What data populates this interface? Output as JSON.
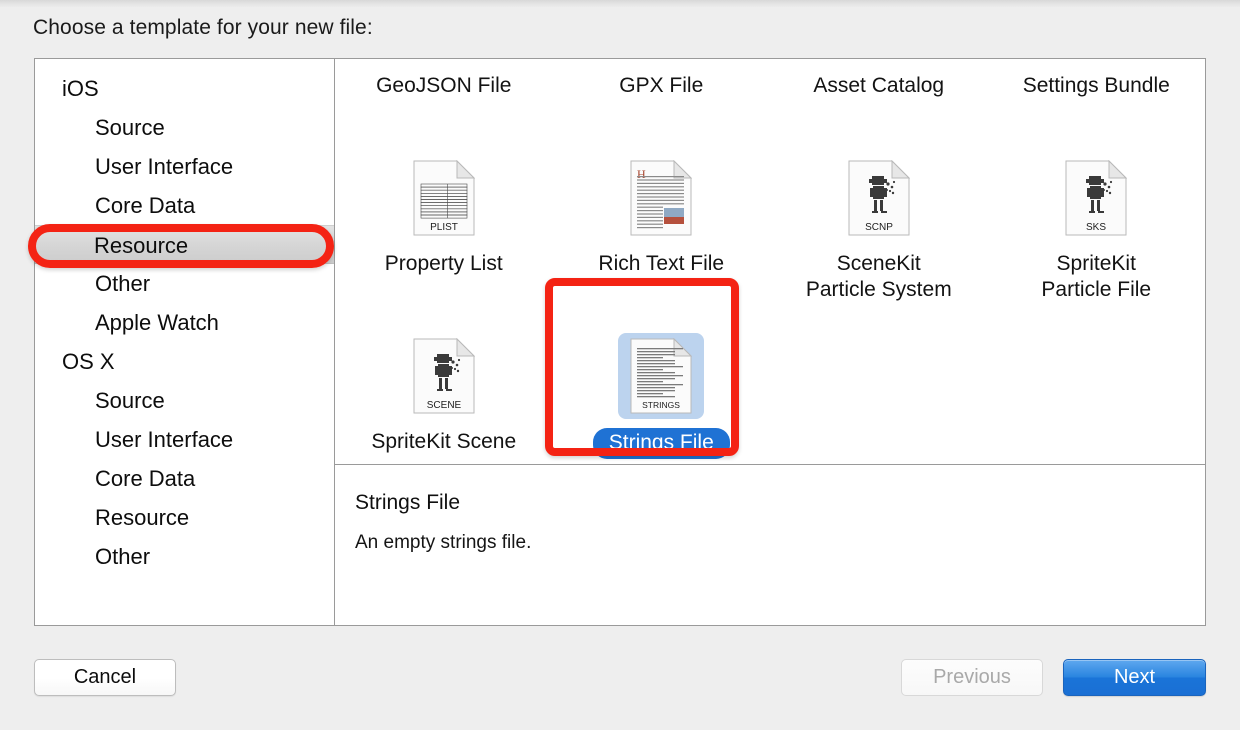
{
  "sheet": {
    "title": "Choose a template for your new file:"
  },
  "sidebar": {
    "groups": [
      {
        "label": "iOS",
        "items": [
          "Source",
          "User Interface",
          "Core Data",
          "Resource",
          "Other",
          "Apple Watch"
        ],
        "selected": "Resource"
      },
      {
        "label": "OS X",
        "items": [
          "Source",
          "User Interface",
          "Core Data",
          "Resource",
          "Other"
        ],
        "selected": null
      }
    ],
    "rows": [
      {
        "label": "iOS",
        "level": "group",
        "selected": false
      },
      {
        "label": "Source",
        "level": "child",
        "selected": false
      },
      {
        "label": "User Interface",
        "level": "child",
        "selected": false
      },
      {
        "label": "Core Data",
        "level": "child",
        "selected": false
      },
      {
        "label": "Resource",
        "level": "child",
        "selected": true
      },
      {
        "label": "Other",
        "level": "child",
        "selected": false
      },
      {
        "label": "Apple Watch",
        "level": "child",
        "selected": false
      },
      {
        "label": "OS X",
        "level": "group",
        "selected": false
      },
      {
        "label": "Source",
        "level": "child",
        "selected": false
      },
      {
        "label": "User Interface",
        "level": "child",
        "selected": false
      },
      {
        "label": "Core Data",
        "level": "child",
        "selected": false
      },
      {
        "label": "Resource",
        "level": "child",
        "selected": false
      },
      {
        "label": "Other",
        "level": "child",
        "selected": false
      }
    ]
  },
  "templates": {
    "tiles": [
      {
        "label": "GeoJSON File",
        "icon": "document-geojson-icon",
        "badge": "",
        "selected": false
      },
      {
        "label": "GPX File",
        "icon": "document-gpx-icon",
        "badge": "",
        "selected": false
      },
      {
        "label": "Asset Catalog",
        "icon": "asset-catalog-icon",
        "badge": "",
        "selected": false
      },
      {
        "label": "Settings Bundle",
        "icon": "settings-bundle-icon",
        "badge": "",
        "selected": false
      },
      {
        "label": "Property List",
        "icon": "document-plist-icon",
        "badge": "PLIST",
        "selected": false
      },
      {
        "label": "Rich Text File",
        "icon": "document-rtf-icon",
        "badge": "",
        "selected": false
      },
      {
        "label": "SceneKit\nParticle System",
        "icon": "document-scnp-icon",
        "badge": "SCNP",
        "selected": false
      },
      {
        "label": "SpriteKit\nParticle File",
        "icon": "document-sks-icon",
        "badge": "SKS",
        "selected": false
      },
      {
        "label": "SpriteKit Scene",
        "icon": "document-scene-icon",
        "badge": "SCENE",
        "selected": false
      },
      {
        "label": "Strings File",
        "icon": "document-strings-icon",
        "badge": "STRINGS",
        "selected": true
      }
    ]
  },
  "description": {
    "title": "Strings File",
    "body": "An empty strings file."
  },
  "buttons": {
    "cancel": "Cancel",
    "previous": "Previous",
    "next": "Next"
  },
  "annotations": [
    {
      "name": "resource-highlight",
      "target": "Resource"
    },
    {
      "name": "strings-file-highlight",
      "target": "Strings File"
    }
  ],
  "colors": {
    "annotation_red": "#f42314",
    "selection_blue": "#1f72d4",
    "icon_selection_blue": "#bcd3ee",
    "default_button_blue": "#2a85e0",
    "sheet_background": "#eeeeee"
  }
}
